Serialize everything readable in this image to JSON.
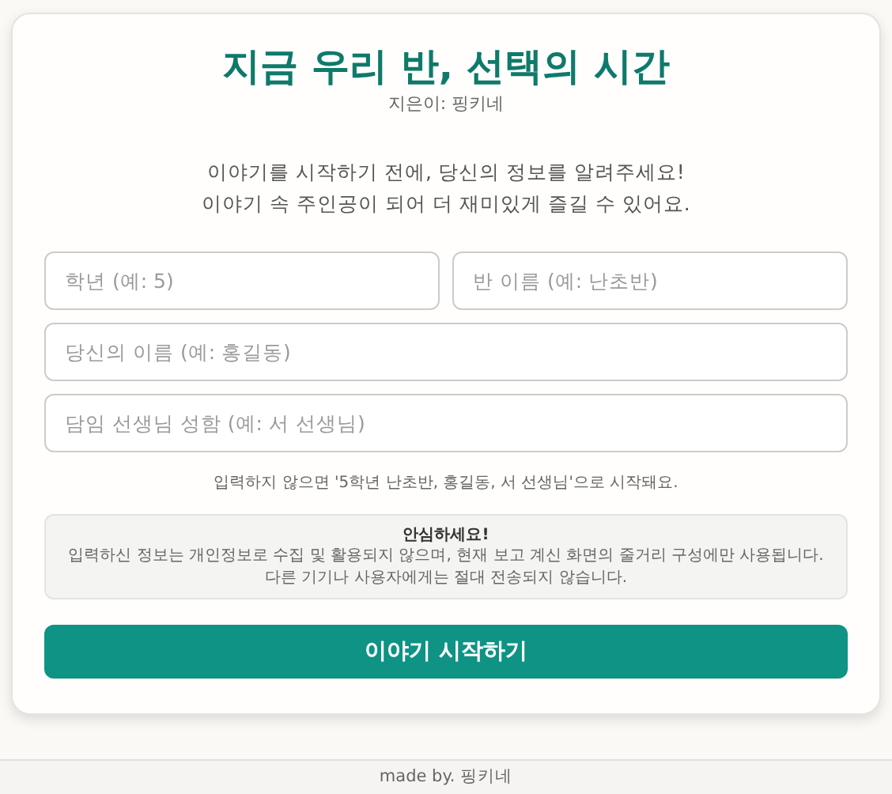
{
  "header": {
    "title": "지금 우리 반, 선택의 시간",
    "author": "지은이: 핑키네"
  },
  "intro": [
    "이야기를 시작하기 전에, 당신의 정보를 알려주세요!",
    "이야기 속 주인공이 되어 더 재미있게 즐길 수 있어요."
  ],
  "fields": [
    [
      {
        "placeholder": "학년 (예: 5)"
      },
      {
        "placeholder": "반 이름 (예: 난초반)"
      }
    ],
    [
      {
        "placeholder": "당신의 이름 (예: 홍길동)"
      }
    ],
    [
      {
        "placeholder": "담임 선생님 성함 (예: 서 선생님)"
      }
    ]
  ],
  "hint": "입력하지 않으면 '5학년 난초반, 홍길동, 서 선생님'으로 시작돼요.",
  "notice": {
    "title": "안심하세요!",
    "body": "입력하신 정보는 개인정보로 수집 및 활용되지 않으며, 현재 보고 계신 화면의 줄거리 구성에만 사용됩니다. 다른 기기나 사용자에게는 절대 전송되지 않습니다."
  },
  "start_button": "이야기 시작하기",
  "footer": "made by. 핑키네"
}
